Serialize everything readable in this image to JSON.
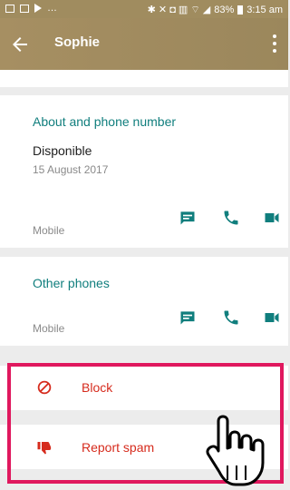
{
  "status": {
    "battery": "83%",
    "time": "3:15 am"
  },
  "appbar": {
    "title": "Sophie"
  },
  "about": {
    "title": "About and phone number",
    "status_text": "Disponible",
    "date": "15 August 2017",
    "phone_type": "Mobile"
  },
  "other_phones": {
    "title": "Other phones",
    "phone_type": "Mobile"
  },
  "actions": {
    "block_label": "Block",
    "spam_label": "Report spam"
  },
  "colors": {
    "accent": "#107e7d",
    "danger": "#d62b1d",
    "appbar": "#a08c5f",
    "highlight": "#e0185e"
  }
}
